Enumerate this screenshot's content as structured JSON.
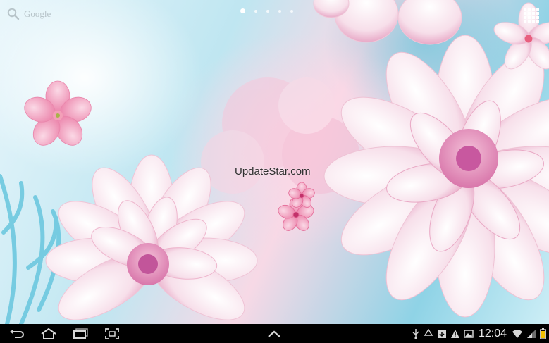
{
  "search": {
    "label": "Google"
  },
  "home_pages": {
    "count": 5,
    "active_index": 0
  },
  "watermark": {
    "text": "UpdateStar.com"
  },
  "status_bar": {
    "time": "12:04"
  },
  "icons": {
    "search": "search-icon",
    "apps": "apps-grid-icon",
    "back": "back-icon",
    "home": "home-icon",
    "recents": "recent-apps-icon",
    "screenshot": "screenshot-icon",
    "menu": "chevron-up-icon",
    "usb": "usb-icon",
    "recycle": "recycle-icon",
    "download": "download-icon",
    "warning": "warning-icon",
    "gallery": "image-icon",
    "wifi": "wifi-icon",
    "signal": "signal-icon",
    "battery": "battery-icon"
  },
  "colors": {
    "nav_bar": "#000000",
    "wallpaper_pink": "#f2b6cf",
    "wallpaper_blue": "#8fd3e6"
  }
}
